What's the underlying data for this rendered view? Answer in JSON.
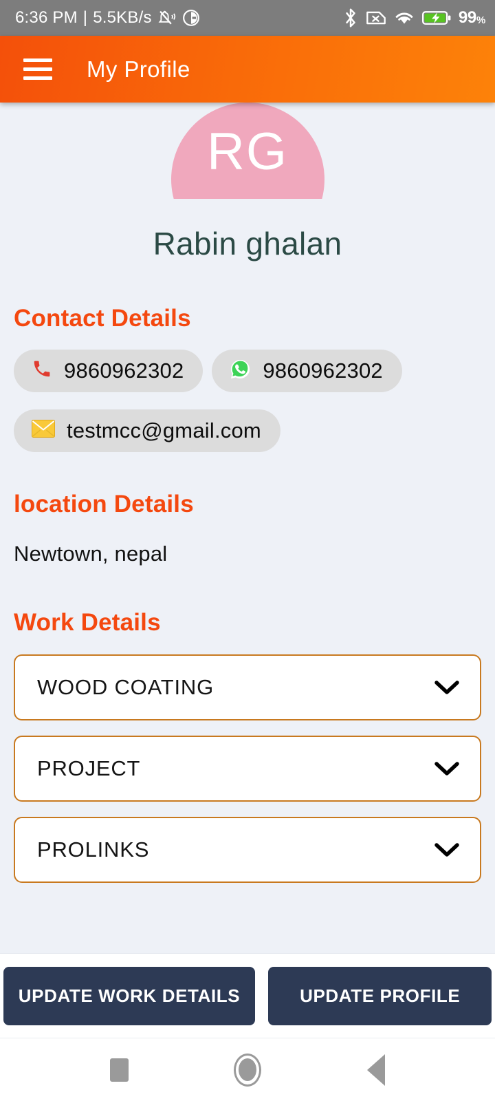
{
  "status_bar": {
    "time": "6:36 PM",
    "separator": "|",
    "network_speed": "5.5KB/s",
    "icons_left": [
      "silent-mode-icon",
      "dnd-icon"
    ],
    "icons_right": [
      "bluetooth-icon",
      "no-sim-icon",
      "wifi-icon",
      "battery-charging-icon"
    ],
    "battery_percent": "99",
    "percent_symbol": "%"
  },
  "app_bar": {
    "menu_icon": "hamburger-menu-icon",
    "title": "My Profile",
    "background_start": "#f4500a",
    "background_end": "#fd8209"
  },
  "profile": {
    "avatar_initials": "RG",
    "avatar_color": "#f0a8bd",
    "name": "Rabin ghalan",
    "name_color": "#2b4a45"
  },
  "contact_section": {
    "title": "Contact Details",
    "title_color": "#f4480f",
    "chips": [
      {
        "icon": "phone-icon",
        "glyph": "📞",
        "value": "9860962302"
      },
      {
        "icon": "whatsapp-icon",
        "glyph": "✆",
        "value": "9860962302"
      },
      {
        "icon": "email-icon",
        "glyph": "✉",
        "value": "testmcc@gmail.com"
      }
    ]
  },
  "location_section": {
    "title": "location Details",
    "value": "Newtown, nepal"
  },
  "work_section": {
    "title": "Work Details",
    "border_color": "#c8791f",
    "items": [
      {
        "label": "WOOD COATING",
        "icon": "chevron-down-icon"
      },
      {
        "label": "PROJECT",
        "icon": "chevron-down-icon"
      },
      {
        "label": "PROLINKS",
        "icon": "chevron-down-icon"
      }
    ]
  },
  "footer": {
    "button_color": "#2d3a55",
    "update_work_label": "UPDATE WORK DETAILS",
    "update_profile_label": "UPDATE PROFILE"
  },
  "nav_bar": {
    "recents": "recents-square-icon",
    "home": "home-circle-icon",
    "back": "back-triangle-icon"
  }
}
